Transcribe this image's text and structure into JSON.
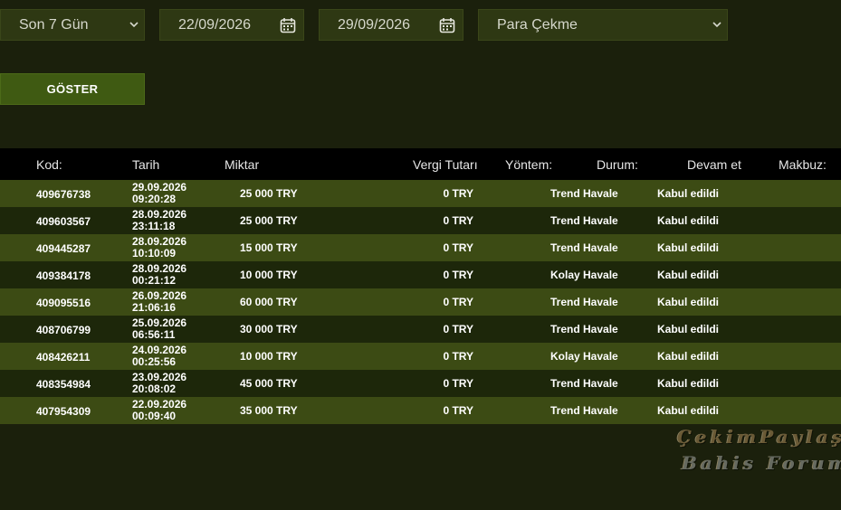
{
  "filters": {
    "range": "Son 7 Gün",
    "date_from": "22/09/2026",
    "date_to": "29/09/2026",
    "type": "Para Çekme"
  },
  "show_button": "GÖSTER",
  "table": {
    "headers": {
      "code": "Kod:",
      "date": "Tarih",
      "amount": "Miktar",
      "tax": "Vergi Tutarı",
      "method": "Yöntem:",
      "status": "Durum:",
      "continue": "Devam et",
      "receipt": "Makbuz:"
    },
    "rows": [
      {
        "code": "409676738",
        "date": "29.09.2026",
        "time": "09:20:28",
        "amount": "25 000 TRY",
        "tax": "0 TRY",
        "method": "Trend Havale",
        "status": "Kabul edildi"
      },
      {
        "code": "409603567",
        "date": "28.09.2026",
        "time": "23:11:18",
        "amount": "25 000 TRY",
        "tax": "0 TRY",
        "method": "Trend Havale",
        "status": "Kabul edildi"
      },
      {
        "code": "409445287",
        "date": "28.09.2026",
        "time": "10:10:09",
        "amount": "15 000 TRY",
        "tax": "0 TRY",
        "method": "Trend Havale",
        "status": "Kabul edildi"
      },
      {
        "code": "409384178",
        "date": "28.09.2026",
        "time": "00:21:12",
        "amount": "10 000 TRY",
        "tax": "0 TRY",
        "method": "Kolay Havale",
        "status": "Kabul edildi"
      },
      {
        "code": "409095516",
        "date": "26.09.2026",
        "time": "21:06:16",
        "amount": "60 000 TRY",
        "tax": "0 TRY",
        "method": "Trend Havale",
        "status": "Kabul edildi"
      },
      {
        "code": "408706799",
        "date": "25.09.2026",
        "time": "06:56:11",
        "amount": "30 000 TRY",
        "tax": "0 TRY",
        "method": "Trend Havale",
        "status": "Kabul edildi"
      },
      {
        "code": "408426211",
        "date": "24.09.2026",
        "time": "00:25:56",
        "amount": "10 000 TRY",
        "tax": "0 TRY",
        "method": "Kolay Havale",
        "status": "Kabul edildi"
      },
      {
        "code": "408354984",
        "date": "23.09.2026",
        "time": "20:08:02",
        "amount": "45 000 TRY",
        "tax": "0 TRY",
        "method": "Trend Havale",
        "status": "Kabul edildi"
      },
      {
        "code": "407954309",
        "date": "22.09.2026",
        "time": "00:09:40",
        "amount": "35 000 TRY",
        "tax": "0 TRY",
        "method": "Trend Havale",
        "status": "Kabul edildi"
      }
    ]
  },
  "watermark": {
    "line1": "ÇekimPaylaş",
    "line2": "Bahis Forum"
  },
  "colors": {
    "background": "#1b200c",
    "control": "#2e3813",
    "button": "#3f5a12",
    "row_odd": "#3c4b14",
    "row_even": "#1d270a",
    "header": "#000000"
  }
}
